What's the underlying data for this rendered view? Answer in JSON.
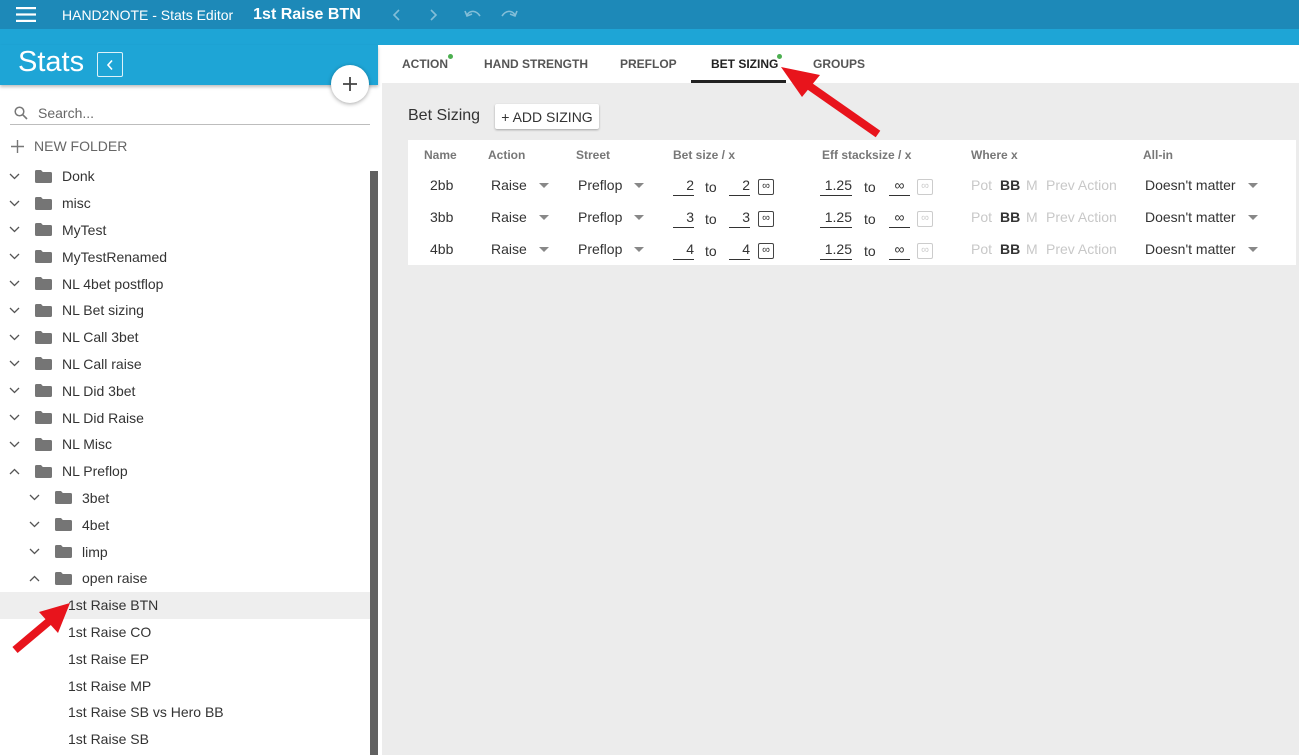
{
  "app": {
    "title": "HAND2NOTE - Stats Editor",
    "document_title": "1st Raise BTN",
    "icons": {
      "menu": "menu-icon",
      "back": "chevron-left-icon",
      "forward": "chevron-right-icon",
      "undo": "undo-icon",
      "redo": "redo-icon"
    }
  },
  "sidebar": {
    "title": "Stats",
    "search_placeholder": "Search...",
    "new_folder_label": "NEW FOLDER",
    "items": [
      {
        "label": "Donk",
        "type": "folder",
        "expanded": false
      },
      {
        "label": "misc",
        "type": "folder",
        "expanded": false
      },
      {
        "label": "MyTest",
        "type": "folder",
        "expanded": false
      },
      {
        "label": "MyTestRenamed",
        "type": "folder",
        "expanded": false
      },
      {
        "label": "NL 4bet postflop",
        "type": "folder",
        "expanded": false
      },
      {
        "label": "NL Bet sizing",
        "type": "folder",
        "expanded": false
      },
      {
        "label": "NL Call 3bet",
        "type": "folder",
        "expanded": false
      },
      {
        "label": "NL Call raise",
        "type": "folder",
        "expanded": false
      },
      {
        "label": "NL Did 3bet",
        "type": "folder",
        "expanded": false
      },
      {
        "label": "NL Did Raise",
        "type": "folder",
        "expanded": false
      },
      {
        "label": "NL Misc",
        "type": "folder",
        "expanded": false
      },
      {
        "label": "NL Preflop",
        "type": "folder",
        "expanded": true
      }
    ],
    "subfolders": [
      {
        "label": "3bet",
        "type": "folder",
        "expanded": false
      },
      {
        "label": "4bet",
        "type": "folder",
        "expanded": false
      },
      {
        "label": "limp",
        "type": "folder",
        "expanded": false
      },
      {
        "label": "open raise",
        "type": "folder",
        "expanded": true
      }
    ],
    "stats": [
      {
        "label": "1st Raise BTN",
        "selected": true
      },
      {
        "label": "1st Raise CO",
        "selected": false
      },
      {
        "label": "1st Raise EP",
        "selected": false
      },
      {
        "label": "1st Raise MP",
        "selected": false
      },
      {
        "label": "1st Raise SB vs Hero BB",
        "selected": false
      },
      {
        "label": "1st Raise SB",
        "selected": false
      }
    ]
  },
  "tabs": [
    {
      "label": "ACTION",
      "dot": true,
      "active": false
    },
    {
      "label": "HAND STRENGTH",
      "dot": false,
      "active": false
    },
    {
      "label": "PREFLOP",
      "dot": false,
      "active": false
    },
    {
      "label": "BET SIZING",
      "dot": true,
      "active": true
    },
    {
      "label": "GROUPS",
      "dot": false,
      "active": false
    }
  ],
  "bet_sizing": {
    "title": "Bet Sizing",
    "add_button": "+ ADD SIZING",
    "columns": {
      "name": "Name",
      "action": "Action",
      "street": "Street",
      "bet_size": "Bet size / x",
      "eff_stack": "Eff stacksize / x",
      "where": "Where x",
      "allin": "All-in"
    },
    "to_label": "to",
    "infinity_symbol": "∞",
    "where_options": [
      "Pot",
      "BB",
      "M",
      "Prev Action"
    ],
    "rows": [
      {
        "name": "2bb",
        "action": "Raise",
        "street": "Preflop",
        "bet_from": "2",
        "bet_to": "2",
        "eff_from": "1.25",
        "eff_to": "∞",
        "where": "BB",
        "allin": "Doesn't matter"
      },
      {
        "name": "3bb",
        "action": "Raise",
        "street": "Preflop",
        "bet_from": "3",
        "bet_to": "3",
        "eff_from": "1.25",
        "eff_to": "∞",
        "where": "BB",
        "allin": "Doesn't matter"
      },
      {
        "name": "4bb",
        "action": "Raise",
        "street": "Preflop",
        "bet_from": "4",
        "bet_to": "4",
        "eff_from": "1.25",
        "eff_to": "∞",
        "where": "BB",
        "allin": "Doesn't matter"
      }
    ]
  },
  "colors": {
    "topbar": "#1d89b8",
    "accent": "#1ea5d6",
    "tab_dot": "#4caf50",
    "annotation_arrow": "#e8141c"
  }
}
